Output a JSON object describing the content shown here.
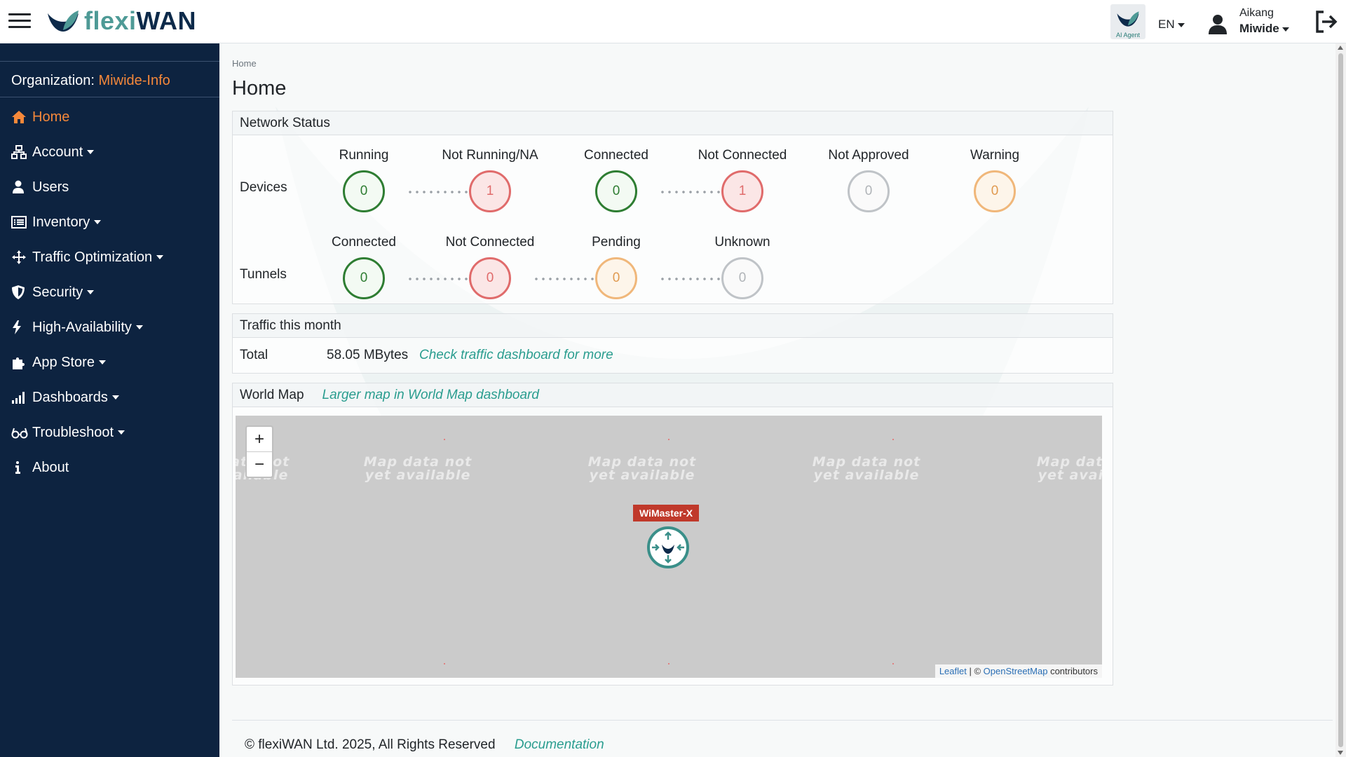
{
  "header": {
    "logo_text_a": "flexi",
    "logo_text_b": "WAN",
    "ai_agent_label": "AI Agent",
    "language": "EN",
    "user_name": "Aikang",
    "user_org": "Miwide",
    "brand_color": "#4e9a96",
    "accent_color": "#f5883a"
  },
  "sidebar": {
    "org_label": "Organization: ",
    "org_name": "Miwide-Info",
    "items": [
      {
        "label": "Home",
        "icon": "home-icon",
        "active": true,
        "dropdown": false
      },
      {
        "label": "Account",
        "icon": "sitemap-icon",
        "dropdown": true
      },
      {
        "label": "Users",
        "icon": "user-icon",
        "dropdown": false
      },
      {
        "label": "Inventory",
        "icon": "list-icon",
        "dropdown": true
      },
      {
        "label": "Traffic Optimization",
        "icon": "arrows-icon",
        "dropdown": true
      },
      {
        "label": "Security",
        "icon": "shield-icon",
        "dropdown": true
      },
      {
        "label": "High-Availability",
        "icon": "bolt-icon",
        "dropdown": true
      },
      {
        "label": "App Store",
        "icon": "puzzle-icon",
        "dropdown": true
      },
      {
        "label": "Dashboards",
        "icon": "signal-icon",
        "dropdown": true
      },
      {
        "label": "Troubleshoot",
        "icon": "glasses-icon",
        "dropdown": true
      },
      {
        "label": "About",
        "icon": "info-icon",
        "dropdown": false
      }
    ]
  },
  "main": {
    "breadcrumb": "Home",
    "title": "Home",
    "network_status": {
      "title": "Network Status",
      "devices": {
        "label": "Devices",
        "items": [
          {
            "label": "Running",
            "value": "0",
            "status": "green"
          },
          {
            "label": "Not Running/NA",
            "value": "1",
            "status": "red"
          },
          {
            "label": "Connected",
            "value": "0",
            "status": "green"
          },
          {
            "label": "Not Connected",
            "value": "1",
            "status": "red"
          },
          {
            "label": "Not Approved",
            "value": "0",
            "status": "gray"
          },
          {
            "label": "Warning",
            "value": "0",
            "status": "orange"
          }
        ]
      },
      "tunnels": {
        "label": "Tunnels",
        "items": [
          {
            "label": "Connected",
            "value": "0",
            "status": "green"
          },
          {
            "label": "Not Connected",
            "value": "0",
            "status": "red"
          },
          {
            "label": "Pending",
            "value": "0",
            "status": "orange"
          },
          {
            "label": "Unknown",
            "value": "0",
            "status": "gray"
          }
        ]
      }
    },
    "traffic": {
      "title": "Traffic this month",
      "total_label": "Total",
      "total_value": "58.05 MBytes",
      "link": "Check traffic dashboard for more"
    },
    "world_map": {
      "title": "World Map",
      "link": "Larger map in World Map dashboard",
      "tile_text": "Map data not yet available",
      "zoom_in": "+",
      "zoom_out": "−",
      "marker_label": "WiMaster-X",
      "attribution_leaflet": "Leaflet",
      "attribution_sep": " | © ",
      "attribution_osm": "OpenStreetMap",
      "attribution_tail": " contributors"
    },
    "footer": {
      "copyright": "© flexiWAN Ltd. 2025, All Rights Reserved",
      "doc_link": "Documentation"
    }
  }
}
